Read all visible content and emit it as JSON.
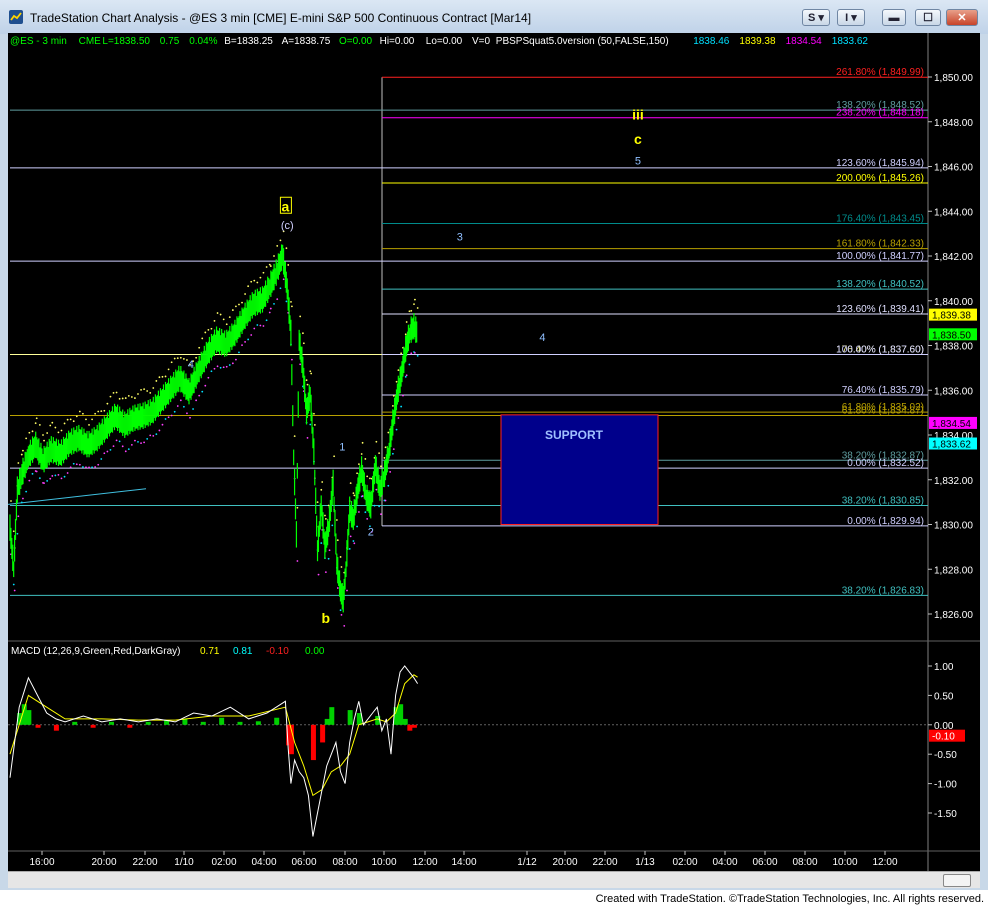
{
  "window": {
    "title": "TradeStation Chart Analysis - @ES 3 min [CME] E-mini S&P 500 Continuous Contract [Mar14]",
    "buttons": {
      "s_label": "S",
      "i_label": "I"
    }
  },
  "status_bar": [
    {
      "text": "@ES - 3 min",
      "color": "#00ff00"
    },
    {
      "text": "CME",
      "color": "#00ff00"
    },
    {
      "text": "L=1838.50",
      "color": "#00ff00"
    },
    {
      "text": "0.75",
      "color": "#00ff00"
    },
    {
      "text": "0.04%",
      "color": "#00ff00"
    },
    {
      "text": "B=1838.25",
      "color": "#ffffff"
    },
    {
      "text": "A=1838.75",
      "color": "#ffffff"
    },
    {
      "text": "O=0.00",
      "color": "#00ff00"
    },
    {
      "text": "Hi=0.00",
      "color": "#ffffff"
    },
    {
      "text": "Lo=0.00",
      "color": "#ffffff"
    },
    {
      "text": "V=0",
      "color": "#ffffff"
    },
    {
      "text": "PBSPSquat5.0version (50,FALSE,150)",
      "color": "#ffffff"
    },
    {
      "text": "1838.46",
      "color": "#00e0ff"
    },
    {
      "text": "1839.38",
      "color": "#ffff00"
    },
    {
      "text": "1834.54",
      "color": "#ff00ff"
    },
    {
      "text": "1833.62",
      "color": "#00e0ff"
    }
  ],
  "chart_data": {
    "type": "candlestick",
    "price_axis": {
      "min": 1824.5,
      "max": 1851.0,
      "ticks": [
        "1,850.00",
        "1,848.00",
        "1,846.00",
        "1,844.00",
        "1,842.00",
        "1,840.00",
        "1,838.00",
        "1,836.00",
        "1,834.00",
        "1,832.00",
        "1,830.00",
        "1,828.00",
        "1,826.00"
      ]
    },
    "time_axis": {
      "ticks": [
        "16:00",
        "20:00",
        "22:00",
        "1/10",
        "02:00",
        "04:00",
        "06:00",
        "08:00",
        "10:00",
        "12:00",
        "14:00",
        "1/12",
        "20:00",
        "22:00",
        "1/13",
        "02:00",
        "04:00",
        "06:00",
        "08:00",
        "10:00",
        "12:00"
      ]
    },
    "price_markers": [
      {
        "label": "1,839.38",
        "price": 1839.38,
        "bg": "#ffff00",
        "fg": "#000000"
      },
      {
        "label": "1,838.50",
        "price": 1838.5,
        "bg": "#00ff00",
        "fg": "#000000"
      },
      {
        "label": "1,834.54",
        "price": 1834.54,
        "bg": "#ff00ff",
        "fg": "#000000"
      },
      {
        "label": "1,833.62",
        "price": 1833.62,
        "bg": "#00ffff",
        "fg": "#000000"
      }
    ],
    "fib_levels": [
      {
        "label": "261.80% (1,849.99)",
        "price": 1849.99,
        "color": "#ff2020",
        "start": "box"
      },
      {
        "label": "138.20% (1,848.52)",
        "price": 1848.52,
        "color": "#5f9ea0",
        "start": "left"
      },
      {
        "label": "238.20% (1,848.18)",
        "price": 1848.18,
        "color": "#ff00ff",
        "start": "box"
      },
      {
        "label": "123.60% (1,845.94)",
        "price": 1845.94,
        "color": "#d0d0ff",
        "start": "left"
      },
      {
        "label": "200.00% (1,845.26)",
        "price": 1845.26,
        "color": "#ffff00",
        "start": "box"
      },
      {
        "label": "176.40% (1,843.45)",
        "price": 1843.45,
        "color": "#008b8b",
        "start": "box"
      },
      {
        "label": "161.80% (1,842.33)",
        "price": 1842.33,
        "color": "#b8a000",
        "start": "box"
      },
      {
        "label": "100.00% (1,841.77)",
        "price": 1841.77,
        "color": "#d0d0ff",
        "start": "left"
      },
      {
        "label": "138.20% (1,840.52)",
        "price": 1840.52,
        "color": "#40c0c0",
        "start": "box"
      },
      {
        "label": "123.60% (1,839.41)",
        "price": 1839.41,
        "color": "#e0e0ff",
        "start": "box"
      },
      {
        "label": "176.40% (1,837.60)",
        "price": 1837.6,
        "color": "#ffff99",
        "start": "left"
      },
      {
        "label": "100.00% (1,837.60)",
        "price": 1837.6,
        "color": "#d0d0ff",
        "start": "box"
      },
      {
        "label": "76.40% (1,835.79)",
        "price": 1835.79,
        "color": "#d0d0ff",
        "start": "box"
      },
      {
        "label": "61.80% (1,835.02)",
        "price": 1835.02,
        "color": "#b8a000",
        "start": "box"
      },
      {
        "label": "61.80% (1,834.87)",
        "price": 1834.87,
        "color": "#b8a000",
        "start": "left"
      },
      {
        "label": "38.20% (1,832.87)",
        "price": 1832.87,
        "color": "#5f9ea0",
        "start": "box"
      },
      {
        "label": "0.00% (1,832.52)",
        "price": 1832.52,
        "color": "#d0d0ff",
        "start": "left"
      },
      {
        "label": "38.20% (1,830.85)",
        "price": 1830.85,
        "color": "#40c0c0",
        "start": "left"
      },
      {
        "label": "0.00% (1,829.94)",
        "price": 1829.94,
        "color": "#d0d0ff",
        "start": "box"
      },
      {
        "label": "38.20% (1,826.83)",
        "price": 1826.83,
        "color": "#40c0c0",
        "start": "left"
      }
    ],
    "support_box": {
      "label": "SUPPORT",
      "price_top": 1834.9,
      "price_bottom": 1830.0,
      "fill": "#00008b",
      "border": "#ff2020"
    },
    "wave_labels": [
      {
        "text": "a",
        "price": 1844.0,
        "t": 0.3,
        "color": "#ffff00",
        "boxed": true
      },
      {
        "text": "(c)",
        "price": 1843.2,
        "t": 0.302,
        "color": "#d0d0ff",
        "boxed": false
      },
      {
        "text": "b",
        "price": 1825.6,
        "t": 0.344,
        "color": "#ffff00",
        "boxed": false
      },
      {
        "text": "4",
        "price": 1837.0,
        "t": 0.197,
        "color": "#8fbfff",
        "boxed": false
      },
      {
        "text": "1",
        "price": 1833.3,
        "t": 0.362,
        "color": "#8fbfff",
        "boxed": false
      },
      {
        "text": "2",
        "price": 1829.5,
        "t": 0.393,
        "color": "#8fbfff",
        "boxed": false
      },
      {
        "text": "3",
        "price": 1842.7,
        "t": 0.49,
        "color": "#8fbfff",
        "boxed": false
      },
      {
        "text": "4",
        "price": 1838.2,
        "t": 0.58,
        "color": "#8fbfff",
        "boxed": false
      },
      {
        "text": "iii",
        "price": 1848.1,
        "t": 0.684,
        "color": "#ffff00",
        "boxed": false
      },
      {
        "text": "c",
        "price": 1847.0,
        "t": 0.684,
        "color": "#ffff00",
        "boxed": false
      },
      {
        "text": "5",
        "price": 1846.1,
        "t": 0.684,
        "color": "#8fbfff",
        "boxed": false
      }
    ],
    "price_path": [
      [
        0.0,
        1829.8
      ],
      [
        0.004,
        1828.0
      ],
      [
        0.008,
        1831.5
      ],
      [
        0.013,
        1832.2
      ],
      [
        0.02,
        1833.0
      ],
      [
        0.028,
        1833.5
      ],
      [
        0.036,
        1832.8
      ],
      [
        0.045,
        1833.3
      ],
      [
        0.055,
        1833.1
      ],
      [
        0.065,
        1833.6
      ],
      [
        0.075,
        1833.8
      ],
      [
        0.085,
        1833.5
      ],
      [
        0.095,
        1833.8
      ],
      [
        0.105,
        1834.3
      ],
      [
        0.115,
        1834.8
      ],
      [
        0.125,
        1834.4
      ],
      [
        0.135,
        1834.7
      ],
      [
        0.145,
        1834.8
      ],
      [
        0.155,
        1835.0
      ],
      [
        0.165,
        1835.5
      ],
      [
        0.175,
        1836.0
      ],
      [
        0.185,
        1836.5
      ],
      [
        0.195,
        1835.9
      ],
      [
        0.205,
        1836.8
      ],
      [
        0.215,
        1837.6
      ],
      [
        0.225,
        1838.2
      ],
      [
        0.235,
        1838.0
      ],
      [
        0.245,
        1838.5
      ],
      [
        0.255,
        1839.2
      ],
      [
        0.265,
        1839.8
      ],
      [
        0.275,
        1840.0
      ],
      [
        0.283,
        1840.6
      ],
      [
        0.29,
        1841.2
      ],
      [
        0.297,
        1842.0
      ],
      [
        0.302,
        1840.5
      ],
      [
        0.306,
        1838.5
      ],
      [
        0.309,
        1833.0
      ],
      [
        0.312,
        1829.5
      ],
      [
        0.315,
        1838.2
      ],
      [
        0.319,
        1837.0
      ],
      [
        0.323,
        1835.0
      ],
      [
        0.327,
        1835.8
      ],
      [
        0.331,
        1833.2
      ],
      [
        0.335,
        1828.8
      ],
      [
        0.339,
        1830.8
      ],
      [
        0.343,
        1829.0
      ],
      [
        0.347,
        1829.8
      ],
      [
        0.352,
        1831.8
      ],
      [
        0.356,
        1828.2
      ],
      [
        0.36,
        1827.0
      ],
      [
        0.363,
        1826.6
      ],
      [
        0.366,
        1828.0
      ],
      [
        0.37,
        1830.6
      ],
      [
        0.374,
        1830.2
      ],
      [
        0.379,
        1831.6
      ],
      [
        0.383,
        1832.4
      ],
      [
        0.388,
        1831.2
      ],
      [
        0.393,
        1830.8
      ],
      [
        0.398,
        1832.6
      ],
      [
        0.403,
        1831.5
      ],
      [
        0.408,
        1832.2
      ],
      [
        0.413,
        1833.3
      ],
      [
        0.417,
        1834.5
      ],
      [
        0.422,
        1835.8
      ],
      [
        0.427,
        1836.8
      ],
      [
        0.431,
        1837.8
      ],
      [
        0.436,
        1838.6
      ],
      [
        0.44,
        1838.8
      ],
      [
        0.444,
        1838.5
      ]
    ],
    "macd": {
      "label": "MACD (12,26,9,Green,Red,DarkGray)",
      "values": [
        "0.71",
        "0.81",
        "-0.10",
        "0.00"
      ],
      "value_colors": [
        "#ffff00",
        "#00ffff",
        "#ff2020",
        "#00ff00"
      ],
      "axis": {
        "min": -2.1,
        "max": 1.2,
        "ticks": [
          "1.00",
          "0.50",
          "0.00",
          "-0.50",
          "-1.00",
          "-1.50"
        ]
      },
      "marker": {
        "label": "-0.10",
        "value": -0.1,
        "bg": "#ff0000",
        "fg": "#ffffff"
      },
      "macd_path": [
        [
          0.0,
          -0.9
        ],
        [
          0.01,
          0.3
        ],
        [
          0.02,
          0.8
        ],
        [
          0.03,
          0.5
        ],
        [
          0.04,
          0.2
        ],
        [
          0.05,
          0.1
        ],
        [
          0.06,
          0.05
        ],
        [
          0.08,
          0.15
        ],
        [
          0.1,
          0.05
        ],
        [
          0.12,
          0.1
        ],
        [
          0.14,
          0.05
        ],
        [
          0.16,
          0.1
        ],
        [
          0.18,
          0.05
        ],
        [
          0.2,
          0.2
        ],
        [
          0.22,
          0.15
        ],
        [
          0.24,
          0.3
        ],
        [
          0.26,
          0.1
        ],
        [
          0.28,
          0.2
        ],
        [
          0.3,
          0.4
        ],
        [
          0.303,
          -0.4
        ],
        [
          0.306,
          -1.0
        ],
        [
          0.31,
          -0.6
        ],
        [
          0.315,
          -0.8
        ],
        [
          0.32,
          -0.9
        ],
        [
          0.325,
          -1.2
        ],
        [
          0.33,
          -1.9
        ],
        [
          0.335,
          -1.5
        ],
        [
          0.34,
          -1.1
        ],
        [
          0.345,
          -0.7
        ],
        [
          0.35,
          -0.5
        ],
        [
          0.355,
          -0.3
        ],
        [
          0.36,
          -0.8
        ],
        [
          0.365,
          -1.0
        ],
        [
          0.37,
          -0.3
        ],
        [
          0.375,
          0.1
        ],
        [
          0.38,
          0.4
        ],
        [
          0.385,
          0.0
        ],
        [
          0.39,
          0.1
        ],
        [
          0.395,
          0.2
        ],
        [
          0.4,
          0.3
        ],
        [
          0.405,
          -0.1
        ],
        [
          0.41,
          0.1
        ],
        [
          0.415,
          -0.5
        ],
        [
          0.42,
          0.5
        ],
        [
          0.425,
          0.9
        ],
        [
          0.43,
          1.0
        ],
        [
          0.435,
          0.9
        ],
        [
          0.44,
          0.8
        ],
        [
          0.444,
          0.7
        ]
      ],
      "signal_path": [
        [
          0.0,
          -0.5
        ],
        [
          0.02,
          0.5
        ],
        [
          0.04,
          0.3
        ],
        [
          0.06,
          0.1
        ],
        [
          0.1,
          0.1
        ],
        [
          0.14,
          0.08
        ],
        [
          0.18,
          0.08
        ],
        [
          0.22,
          0.15
        ],
        [
          0.26,
          0.15
        ],
        [
          0.3,
          0.3
        ],
        [
          0.31,
          -0.3
        ],
        [
          0.32,
          -0.7
        ],
        [
          0.33,
          -1.2
        ],
        [
          0.34,
          -1.1
        ],
        [
          0.35,
          -0.8
        ],
        [
          0.36,
          -0.7
        ],
        [
          0.37,
          -0.5
        ],
        [
          0.38,
          0.0
        ],
        [
          0.39,
          0.05
        ],
        [
          0.4,
          0.1
        ],
        [
          0.41,
          0.05
        ],
        [
          0.42,
          0.2
        ],
        [
          0.43,
          0.7
        ],
        [
          0.44,
          0.85
        ],
        [
          0.444,
          0.81
        ]
      ],
      "hist": [
        [
          0.01,
          0.2
        ],
        [
          0.015,
          0.35
        ],
        [
          0.02,
          0.25
        ],
        [
          0.03,
          -0.05
        ],
        [
          0.05,
          -0.1
        ],
        [
          0.07,
          0.05
        ],
        [
          0.09,
          -0.05
        ],
        [
          0.11,
          0.05
        ],
        [
          0.13,
          -0.05
        ],
        [
          0.15,
          0.05
        ],
        [
          0.17,
          0.08
        ],
        [
          0.19,
          0.1
        ],
        [
          0.21,
          0.05
        ],
        [
          0.23,
          0.12
        ],
        [
          0.25,
          0.05
        ],
        [
          0.27,
          0.06
        ],
        [
          0.29,
          0.12
        ],
        [
          0.303,
          -0.35
        ],
        [
          0.306,
          -0.5
        ],
        [
          0.33,
          -0.6
        ],
        [
          0.34,
          -0.3
        ],
        [
          0.345,
          0.1
        ],
        [
          0.35,
          0.3
        ],
        [
          0.37,
          0.25
        ],
        [
          0.38,
          0.2
        ],
        [
          0.4,
          0.15
        ],
        [
          0.42,
          0.3
        ],
        [
          0.425,
          0.35
        ],
        [
          0.43,
          0.1
        ],
        [
          0.435,
          -0.1
        ],
        [
          0.44,
          -0.05
        ]
      ]
    }
  },
  "footer": "Created with TradeStation. ©TradeStation Technologies, Inc. All rights reserved."
}
